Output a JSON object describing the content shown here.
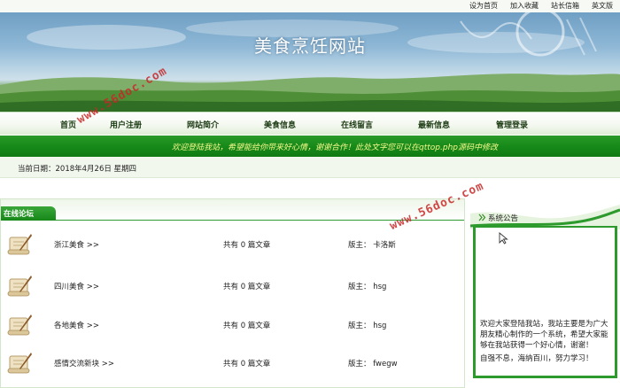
{
  "topbar": {
    "links": [
      "设为首页",
      "加入收藏",
      "站长信箱",
      "英文版"
    ]
  },
  "banner": {
    "title": "美食烹饪网站"
  },
  "nav": {
    "items": [
      "首页",
      "用户注册",
      "网站简介",
      "美食信息",
      "在线留言",
      "最新信息",
      "管理登录"
    ]
  },
  "welcome": {
    "text": "欢迎登陆我站，希望能给你带来好心情，谢谢合作！此处文字您可以在qttop.php源码中修改"
  },
  "datebar": {
    "text": "当前日期：2018年4月26日 星期四"
  },
  "forum": {
    "tab_label": "在线论坛",
    "rows": [
      {
        "name": "浙江美食  >>",
        "count": "共有  0  篇文章",
        "moderator": "版主：  卡洛斯"
      },
      {
        "name": "四川美食  >>",
        "count": "共有  0  篇文章",
        "moderator": "版主：  hsg"
      },
      {
        "name": "各地美食  >>",
        "count": "共有  0  篇文章",
        "moderator": "版主：  hsg"
      },
      {
        "name": "感情交流新块  >>",
        "count": "共有  0  篇文章",
        "moderator": "版主：  fwegw"
      }
    ]
  },
  "notice": {
    "title": "系统公告",
    "paragraph1": "欢迎大家登陆我站，我站主要是为广大朋友精心制作的一个系统，希望大家能够在我站获得一个好心情，谢谢！",
    "paragraph2": "自强不息，海纳百川，努力学习！"
  },
  "watermark": {
    "text": "www.56doc.com"
  },
  "colors": {
    "green_dark": "#178a1a",
    "welcome_text": "#f4f88a",
    "watermark": "#c82828"
  },
  "icons": {
    "forum_row": "scroll-quill-icon",
    "notice_head": "chevron-double-icon",
    "cursor": "mouse-pointer-icon"
  }
}
